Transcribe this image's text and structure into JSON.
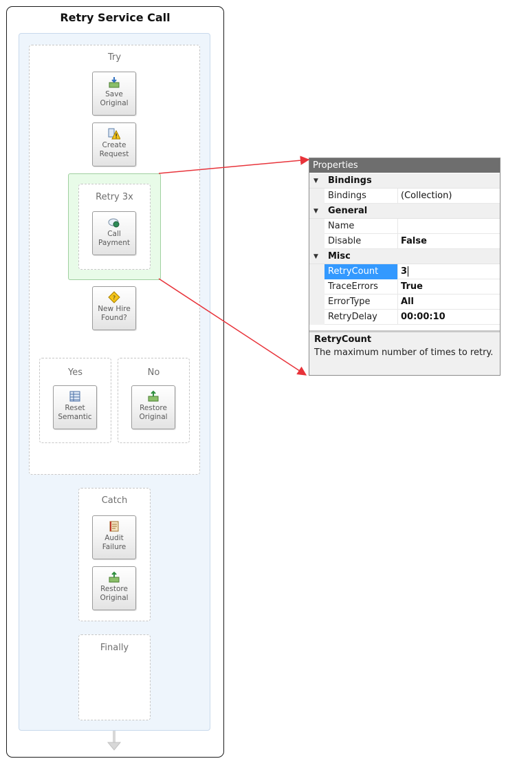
{
  "workflow": {
    "title": "Retry Service Call",
    "try": {
      "label": "Try",
      "activities": [
        {
          "label_1": "Save",
          "label_2": "Original",
          "icon": "save-icon"
        },
        {
          "label_1": "Create",
          "label_2": "Request",
          "icon": "create-request-warning-icon"
        }
      ],
      "retry_scope": {
        "label": "Retry 3x",
        "activity": {
          "label_1": "Call",
          "label_2": "Payment",
          "icon": "service-call-icon"
        }
      },
      "decision": {
        "label_1": "New Hire",
        "label_2": "Found?",
        "icon": "decision-diamond-icon"
      },
      "branches": [
        {
          "label": "Yes",
          "activity": {
            "label_1": "Reset",
            "label_2": "Semantic",
            "icon": "table-icon"
          }
        },
        {
          "label": "No",
          "activity": {
            "label_1": "Restore",
            "label_2": "Original",
            "icon": "restore-icon"
          }
        }
      ]
    },
    "catch": {
      "label": "Catch",
      "activities": [
        {
          "label_1": "Audit",
          "label_2": "Failure",
          "icon": "audit-book-icon"
        },
        {
          "label_1": "Restore",
          "label_2": "Original",
          "icon": "restore-icon"
        }
      ]
    },
    "finally": {
      "label": "Finally"
    }
  },
  "properties": {
    "title": "Properties",
    "categories": [
      {
        "name": "Bindings",
        "rows": [
          {
            "name": "Bindings",
            "value": "(Collection)"
          }
        ]
      },
      {
        "name": "General",
        "rows": [
          {
            "name": "Name",
            "value": ""
          },
          {
            "name": "Disable",
            "value": "False"
          }
        ]
      },
      {
        "name": "Misc",
        "rows": [
          {
            "name": "RetryCount",
            "value": "3"
          },
          {
            "name": "TraceErrors",
            "value": "True"
          },
          {
            "name": "ErrorType",
            "value": "All"
          },
          {
            "name": "RetryDelay",
            "value": "00:00:10"
          }
        ]
      }
    ],
    "description": {
      "title": "RetryCount",
      "text": "The maximum number of times to retry."
    }
  },
  "colors": {
    "callout_arrow": "#e8333a",
    "retry_scope_fill": "#e8fbe8",
    "selected_row": "#3399ff",
    "panel_header": "#6e6e6e"
  }
}
